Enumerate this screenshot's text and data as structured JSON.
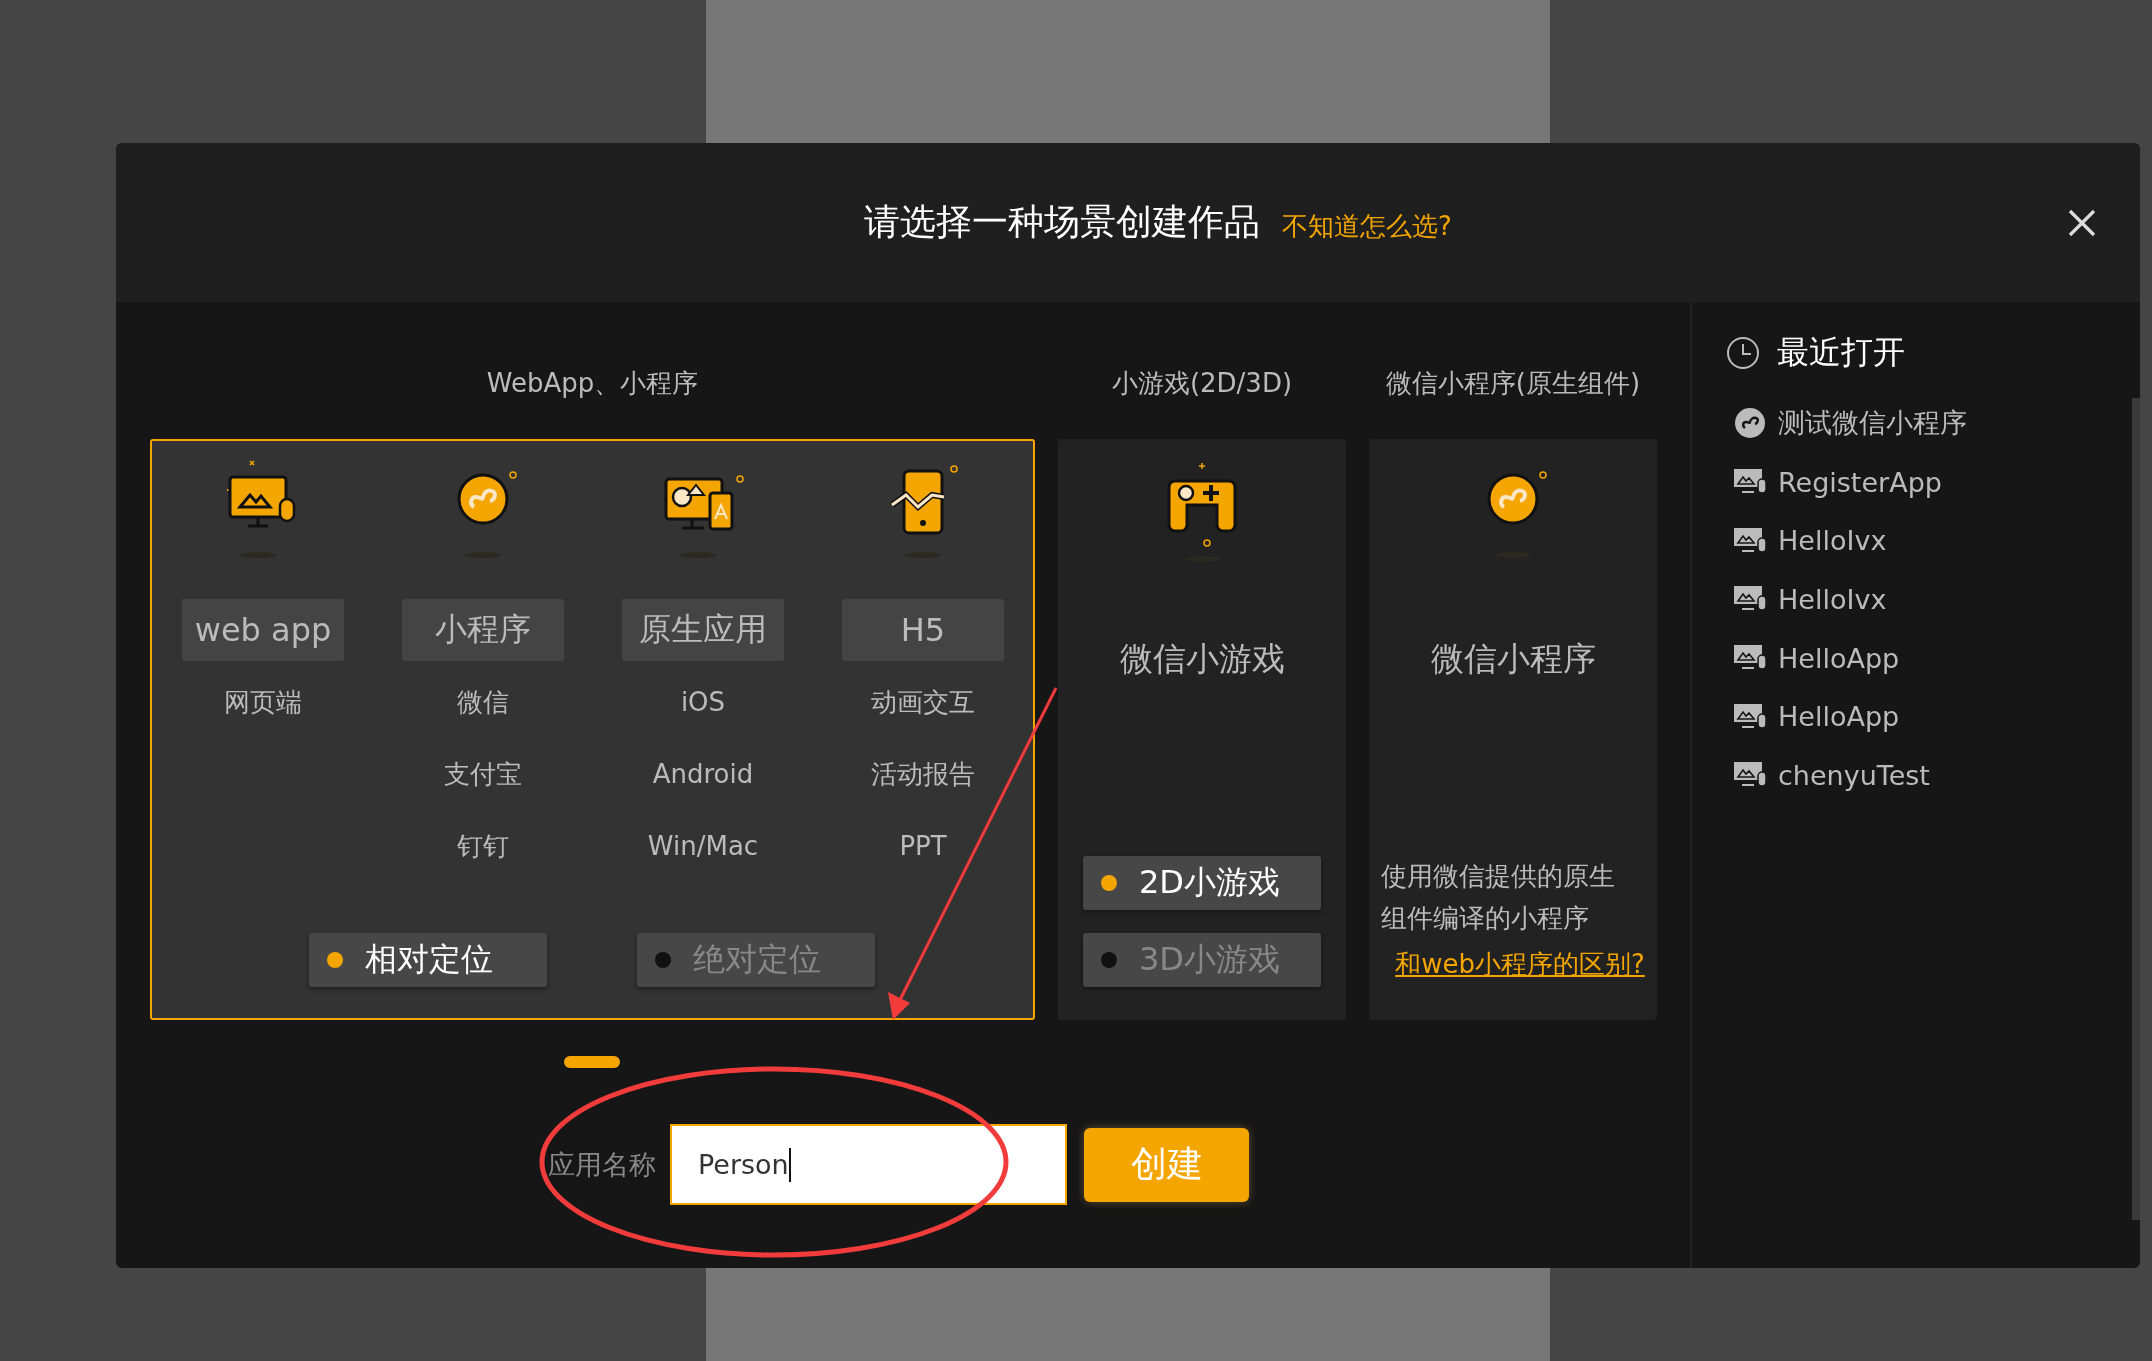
{
  "dialog": {
    "title": "请选择一种场景创建作品",
    "help_link": "不知道怎么选?"
  },
  "webapp_section": {
    "heading": "WebApp、小程序",
    "selected": true,
    "types": [
      {
        "kind": "webapp",
        "label": "web app",
        "platforms": [
          "网页端"
        ]
      },
      {
        "kind": "miniprogram",
        "label": "小程序",
        "platforms": [
          "微信",
          "支付宝",
          "钉钉"
        ]
      },
      {
        "kind": "native",
        "label": "原生应用",
        "platforms": [
          "iOS",
          "Android",
          "Win/Mac"
        ]
      },
      {
        "kind": "h5",
        "label": "H5",
        "platforms": [
          "动画交互",
          "活动报告",
          "PPT"
        ]
      }
    ],
    "modes": [
      {
        "label": "相对定位",
        "selected": true
      },
      {
        "label": "绝对定位",
        "selected": false
      }
    ]
  },
  "game_section": {
    "heading": "小游戏(2D/3D)",
    "selected": false,
    "title": "微信小游戏",
    "modes": [
      {
        "label": "2D小游戏",
        "selected": true
      },
      {
        "label": "3D小游戏",
        "selected": false
      }
    ]
  },
  "native_section": {
    "heading": "微信小程序(原生组件)",
    "selected": false,
    "title": "微信小程序",
    "description": "使用微信提供的原生组件编译的小程序",
    "link": "和web小程序的区别?"
  },
  "create_form": {
    "label": "应用名称",
    "value": "Person",
    "button": "创建"
  },
  "recent": {
    "heading": "最近打开",
    "items": [
      {
        "kind": "miniprogram",
        "name": "测试微信小程序"
      },
      {
        "kind": "webapp",
        "name": "RegisterApp"
      },
      {
        "kind": "webapp",
        "name": "HelloIvx"
      },
      {
        "kind": "webapp",
        "name": "HelloIvx"
      },
      {
        "kind": "webapp",
        "name": "HelloApp"
      },
      {
        "kind": "webapp",
        "name": "HelloApp"
      },
      {
        "kind": "webapp",
        "name": "chenyuTest"
      }
    ]
  }
}
